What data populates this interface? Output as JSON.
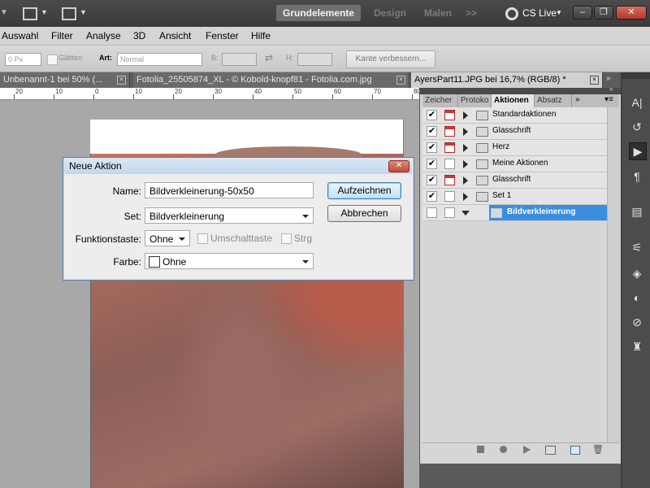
{
  "appbar": {
    "workspaces": [
      "Grundelemente",
      "Design",
      "Malen"
    ],
    "more": ">>",
    "cslive": "CS Live"
  },
  "menu": [
    "Auswahl",
    "Filter",
    "Analyse",
    "3D",
    "Ansicht",
    "Fenster",
    "Hilfe"
  ],
  "options": {
    "feather_value": "0 Px",
    "antialias_label": "Glätten",
    "style_label": "Art:",
    "style_value": "Normal",
    "width_label": "B:",
    "height_label": "H:",
    "refine_button": "Kante verbessern..."
  },
  "doc_tabs": [
    "Unbenannt-1 bei 50% (...",
    "Fotolia_25505874_XL - © Kobold-knopf81 - Fotolia.com.jpg",
    "AyersPart11.JPG bei 16,7% (RGB/8) *"
  ],
  "ruler_labels": [
    "20",
    "10",
    "0",
    "10",
    "20",
    "30",
    "40",
    "50",
    "60",
    "70",
    "80"
  ],
  "panel": {
    "tabs": [
      "Zeicher",
      "Protoko",
      "Aktionen",
      "Absatz"
    ],
    "actions": [
      {
        "label": "Standardaktionen",
        "checked": true,
        "dialog": true
      },
      {
        "label": "Glasschrift",
        "checked": true,
        "dialog": true
      },
      {
        "label": "Herz",
        "checked": true,
        "dialog": true
      },
      {
        "label": "Meine Aktionen",
        "checked": true,
        "dialog": false
      },
      {
        "label": "Glasschrift",
        "checked": true,
        "dialog": true
      },
      {
        "label": "Set 1",
        "checked": true,
        "dialog": false
      },
      {
        "label": "Bildverkleinerung",
        "checked": false,
        "dialog": false,
        "selected": true
      }
    ]
  },
  "dialog": {
    "title": "Neue Aktion",
    "name_label": "Name:",
    "name_value": "Bildverkleinerung-50x50",
    "set_label": "Set:",
    "set_value": "Bildverkleinerung",
    "fkey_label": "Funktionstaste:",
    "fkey_value": "Ohne",
    "shift_label": "Umschalttaste",
    "ctrl_label": "Strg",
    "color_label": "Farbe:",
    "color_value": "Ohne",
    "record_button": "Aufzeichnen",
    "cancel_button": "Abbrechen"
  },
  "colors": {
    "selection": "#3b8de0",
    "dialog_border": "#5a7fa8"
  }
}
